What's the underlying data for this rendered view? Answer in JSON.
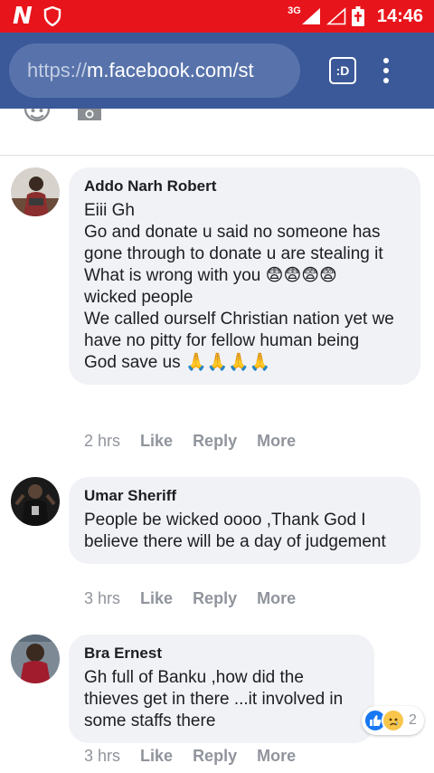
{
  "status_bar": {
    "network": "3G",
    "time": "14:46"
  },
  "browser": {
    "url_protocol": "https://",
    "url_host": "m.facebook.com/st",
    "tab_label": ":D"
  },
  "comments": [
    {
      "author": "Addo Narh Robert",
      "lines": [
        "Eiii Gh",
        "Go and donate u said no someone has gone through to donate u are stealing it",
        "What is wrong with you 😨😨😨😨",
        "wicked people",
        "We called ourself Christian nation yet we have no pitty for fellow human being",
        "God save us 🙏🙏🙏🙏"
      ],
      "time": "2 hrs",
      "like_label": "Like",
      "reply_label": "Reply",
      "more_label": "More"
    },
    {
      "author": "Umar Sheriff",
      "lines": [
        "People be wicked oooo ,Thank God I believe there will be a day of judgement"
      ],
      "time": "3 hrs",
      "like_label": "Like",
      "reply_label": "Reply",
      "more_label": "More"
    },
    {
      "author": "Bra Ernest",
      "lines": [
        "Gh full of Banku ,how did the thieves get in there ...it involved in some staffs there"
      ],
      "time": "3 hrs",
      "like_label": "Like",
      "reply_label": "Reply",
      "more_label": "More",
      "reaction_count": "2"
    }
  ],
  "colors": {
    "status_bar": "#e8141b",
    "browser_bar": "#3b5998",
    "bubble": "#f1f2f6",
    "meta_text": "#90949c"
  }
}
